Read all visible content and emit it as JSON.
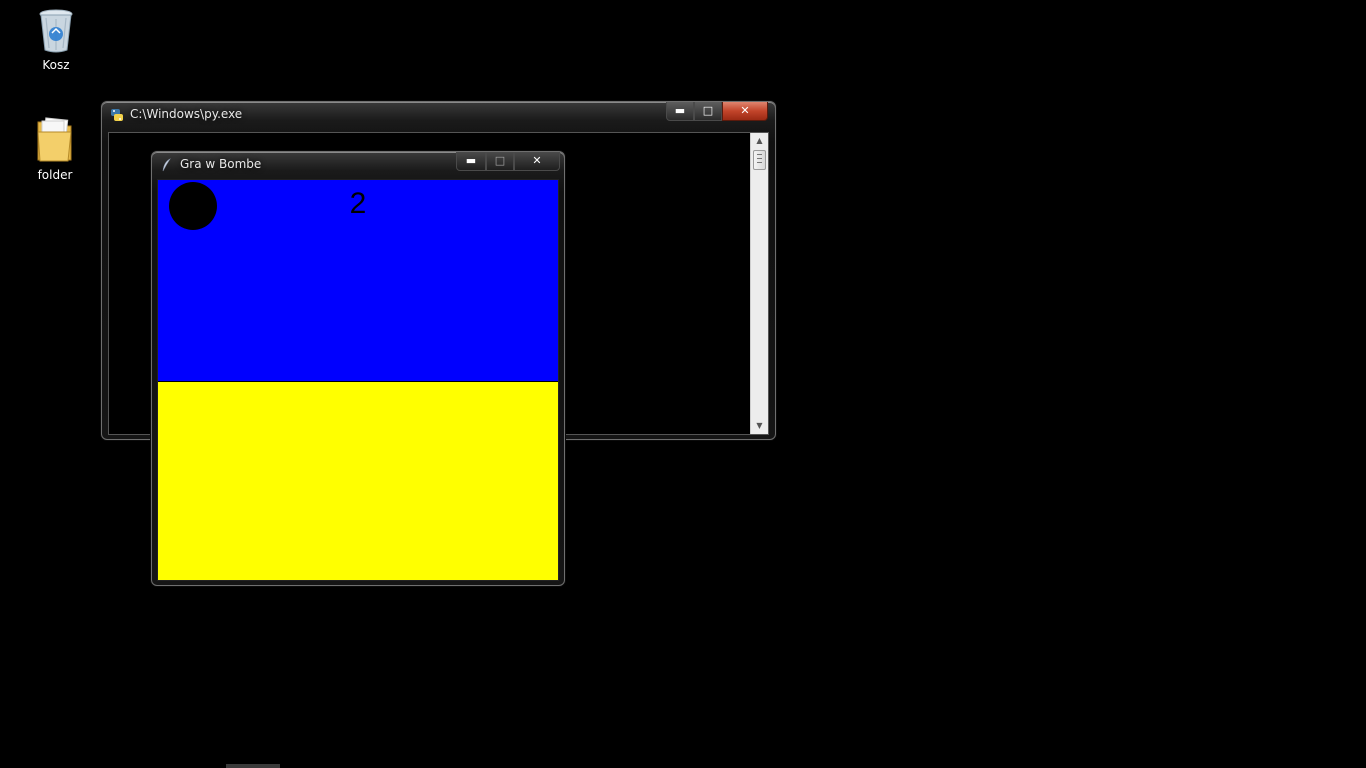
{
  "desktop": {
    "icons": [
      {
        "label": "Kosz",
        "icon": "recycle-bin-icon"
      },
      {
        "label": "folder",
        "icon": "folder-icon"
      }
    ]
  },
  "console_window": {
    "title": "C:\\Windows\\py.exe",
    "icon": "python-icon",
    "buttons": {
      "minimize": "minimize-icon",
      "maximize": "maximize-icon",
      "close": "close-icon"
    }
  },
  "game_window": {
    "title": "Gra w Bombe",
    "icon": "tk-feather-icon",
    "buttons": {
      "minimize": "minimize-icon",
      "maximize": "maximize-icon",
      "close": "close-icon"
    },
    "canvas": {
      "score": "2",
      "sky_color": "#0000ff",
      "ground_color": "#ffff00",
      "bomb_color": "#000000"
    }
  }
}
